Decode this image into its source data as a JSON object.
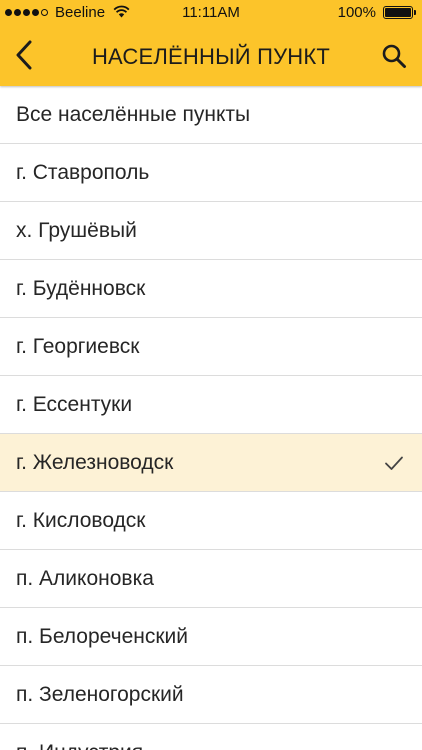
{
  "status_bar": {
    "carrier": "Beeline",
    "time": "11:11AM",
    "battery": "100%"
  },
  "nav": {
    "title": "НАСЕЛЁННЫЙ ПУНКТ",
    "back_icon": "chevron-left-icon",
    "search_icon": "search-icon"
  },
  "colors": {
    "header": "#FCC42A",
    "selected_row": "#FDF2D6"
  },
  "list": {
    "items": [
      {
        "label": "Все населённые пункты",
        "selected": false
      },
      {
        "label": "г. Ставрополь",
        "selected": false
      },
      {
        "label": "х. Грушёвый",
        "selected": false
      },
      {
        "label": "г. Будённовск",
        "selected": false
      },
      {
        "label": "г. Георгиевск",
        "selected": false
      },
      {
        "label": "г. Ессентуки",
        "selected": false
      },
      {
        "label": "г. Железноводск",
        "selected": true
      },
      {
        "label": "г. Кисловодск",
        "selected": false
      },
      {
        "label": "п. Аликоновка",
        "selected": false
      },
      {
        "label": "п. Белореченский",
        "selected": false
      },
      {
        "label": "п. Зеленогорский",
        "selected": false
      },
      {
        "label": "п. Индустрия",
        "selected": false
      }
    ]
  }
}
